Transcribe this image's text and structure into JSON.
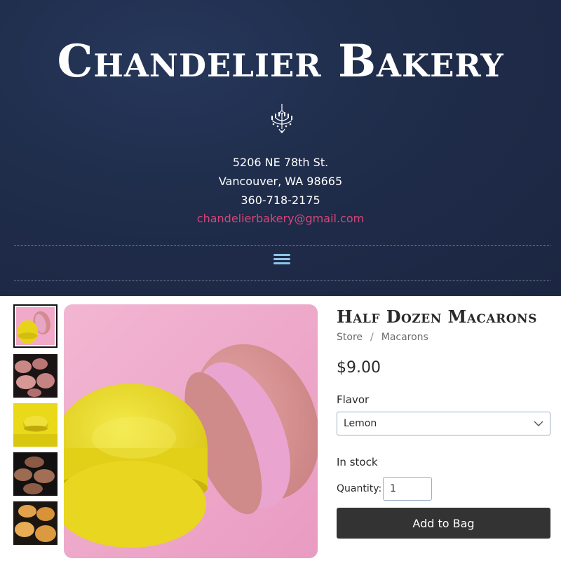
{
  "header": {
    "title": "Chandelier Bakery",
    "logo_icon": "chandelier-icon",
    "address_line1": "5206 NE 78th St.",
    "address_line2": "Vancouver, WA 98665",
    "phone": "360-718-2175",
    "email": "chandelierbakery@gmail.com",
    "menu_icon": "hamburger-menu-icon",
    "colors": {
      "background": "#1f2c4a",
      "email": "#d6467a",
      "menu_icon": "#8ec4ea"
    }
  },
  "gallery": {
    "selected_index": 0,
    "thumbnails": [
      "yellow and pink macarons",
      "pink macarons",
      "yellow macaron",
      "chocolate macarons",
      "orange macarons"
    ]
  },
  "product": {
    "title": "Half Dozen Macarons",
    "breadcrumb": [
      "Store",
      "Macarons"
    ],
    "breadcrumb_separator": "/",
    "price": "$9.00",
    "flavor_label": "Flavor",
    "flavor_selected": "Lemon",
    "stock_status": "In stock",
    "quantity_label": "Quantity:",
    "quantity_value": "1",
    "add_button_label": "Add to Bag",
    "colors": {
      "button": "#333333"
    }
  }
}
